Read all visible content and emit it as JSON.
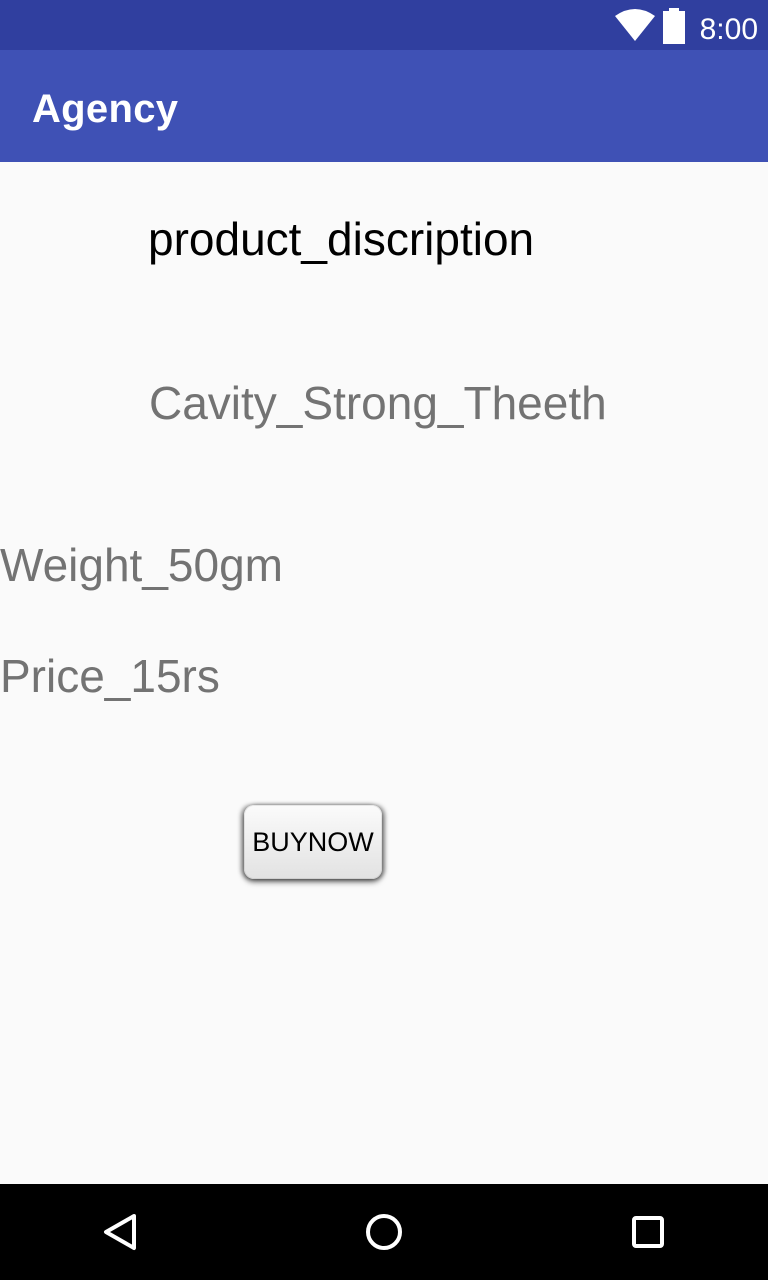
{
  "status_bar": {
    "time": "8:00",
    "icons": [
      "wifi-icon",
      "battery-icon"
    ]
  },
  "app_bar": {
    "title": "Agency"
  },
  "product": {
    "heading": "product_discription",
    "name": "Cavity_Strong_Theeth",
    "weight": "Weight_50gm",
    "price": "Price_15rs"
  },
  "actions": {
    "buy_label": "BUYNOW"
  },
  "nav_bar": {
    "icons": [
      "back-icon",
      "home-icon",
      "recents-icon"
    ]
  },
  "colors": {
    "status_bar": "#303f9f",
    "app_bar": "#3f51b5",
    "background": "#fafafa",
    "secondary_text": "#737373"
  }
}
